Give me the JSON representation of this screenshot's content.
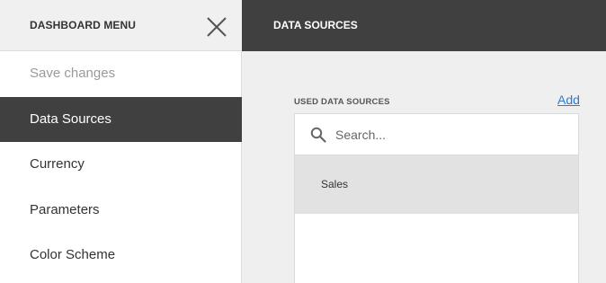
{
  "menu": {
    "title": "DASHBOARD MENU",
    "close_icon": "close-icon",
    "items": [
      {
        "label": "Save changes",
        "state": "disabled"
      },
      {
        "label": "Data Sources",
        "state": "active"
      },
      {
        "label": "Currency",
        "state": "normal"
      },
      {
        "label": "Parameters",
        "state": "normal"
      },
      {
        "label": "Color Scheme",
        "state": "normal"
      }
    ]
  },
  "content": {
    "title": "DATA SOURCES",
    "section_label": "USED DATA SOURCES",
    "add_label": "Add",
    "search": {
      "placeholder": "Search...",
      "value": "",
      "icon": "search-icon"
    },
    "data_sources": [
      {
        "label": "Sales",
        "selected": true
      }
    ]
  },
  "colors": {
    "dark": "#404040",
    "header_light": "#f0f0f0",
    "panel_bg": "#efefef",
    "link": "#2b7bd0",
    "selected_item": "#e2e2e2"
  }
}
